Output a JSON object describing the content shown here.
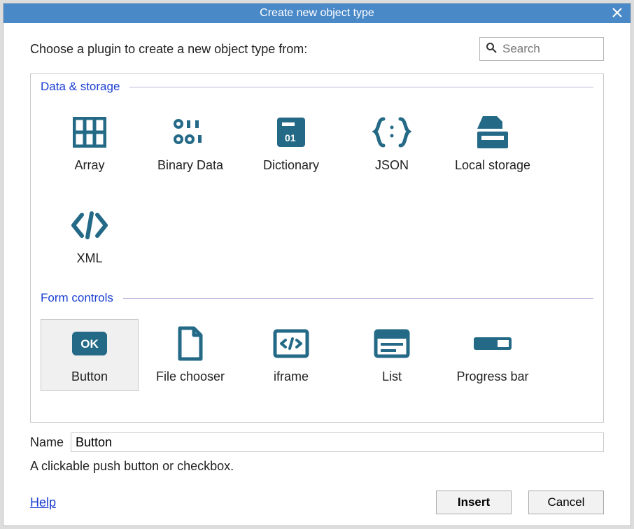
{
  "title": "Create new object type",
  "prompt": "Choose a plugin to create a new object type from:",
  "search": {
    "placeholder": "Search"
  },
  "groups": {
    "data_storage": {
      "title": "Data & storage",
      "items": {
        "array": "Array",
        "binary_data": "Binary Data",
        "dictionary": "Dictionary",
        "json": "JSON",
        "local_storage": "Local storage",
        "xml": "XML"
      }
    },
    "form_controls": {
      "title": "Form controls",
      "items": {
        "button": "Button",
        "file_chooser": "File chooser",
        "iframe": "iframe",
        "list": "List",
        "progress_bar": "Progress bar"
      }
    }
  },
  "selected_plugin": "button",
  "name": {
    "label": "Name",
    "value": "Button"
  },
  "description": "A clickable push button or checkbox.",
  "buttons": {
    "help": "Help",
    "insert": "Insert",
    "cancel": "Cancel"
  },
  "colors": {
    "accent": "#4a89c8",
    "icon": "#246a87",
    "group_label": "#1a3fd1"
  }
}
